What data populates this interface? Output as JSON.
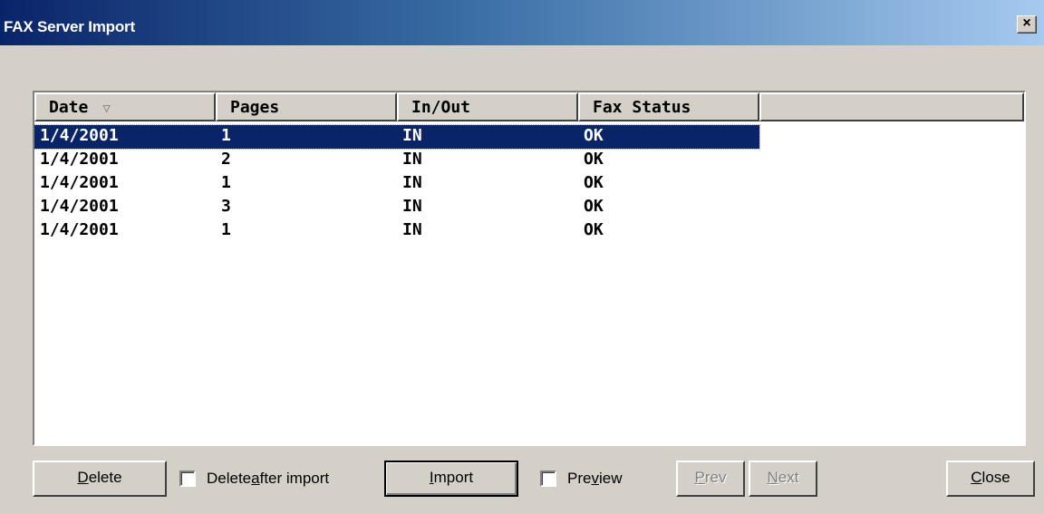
{
  "window": {
    "title": "FAX Server Import",
    "close_label": "×"
  },
  "list": {
    "columns": [
      "Date",
      "Pages",
      "In/Out",
      "Fax Status"
    ],
    "sort_indicator": "▽",
    "rows": [
      {
        "date": "1/4/2001",
        "pages": "1",
        "inout": "IN",
        "status": "OK",
        "selected": true
      },
      {
        "date": "1/4/2001",
        "pages": "2",
        "inout": "IN",
        "status": "OK",
        "selected": false
      },
      {
        "date": "1/4/2001",
        "pages": "1",
        "inout": "IN",
        "status": "OK",
        "selected": false
      },
      {
        "date": "1/4/2001",
        "pages": "3",
        "inout": "IN",
        "status": "OK",
        "selected": false
      },
      {
        "date": "1/4/2001",
        "pages": "1",
        "inout": "IN",
        "status": "OK",
        "selected": false
      }
    ]
  },
  "buttons": {
    "delete": {
      "pre": "",
      "mnemonic": "D",
      "post": "elete"
    },
    "import": {
      "pre": "",
      "mnemonic": "I",
      "post": "mport"
    },
    "prev": {
      "pre": "",
      "mnemonic": "P",
      "post": "rev"
    },
    "next": {
      "pre": "",
      "mnemonic": "N",
      "post": "ext"
    },
    "close": {
      "pre": "",
      "mnemonic": "C",
      "post": "lose"
    }
  },
  "checkboxes": {
    "delete_after_import": {
      "pre": "Delete ",
      "mnemonic": "a",
      "post": "fter import",
      "checked": false
    },
    "preview": {
      "pre": "Pre",
      "mnemonic": "v",
      "post": "iew",
      "checked": false
    }
  }
}
